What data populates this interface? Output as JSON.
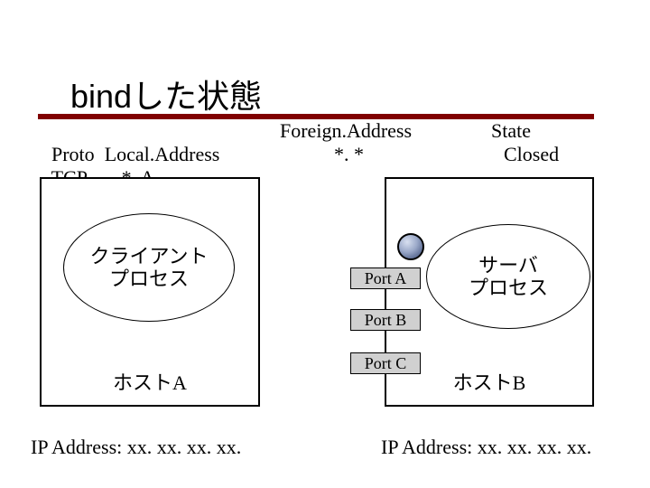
{
  "title": "bindした状態",
  "table": {
    "head_proto": "Proto",
    "head_local": "Local.Address",
    "head_foreign": "Foreign.Address",
    "head_state": "State",
    "row_proto": "TCP",
    "row_local": "*. A",
    "row_foreign": "*. *",
    "row_state": "Closed"
  },
  "client": {
    "process_label": "クライアント\nプロセス",
    "host_label": "ホストA",
    "ip": "IP Address: xx. xx. xx. xx."
  },
  "server": {
    "process_label": "サーバ\nプロセス",
    "host_label": "ホストB",
    "ip": "IP Address: xx. xx. xx. xx."
  },
  "ports": {
    "a": "Port A",
    "b": "Port B",
    "c": "Port C"
  }
}
